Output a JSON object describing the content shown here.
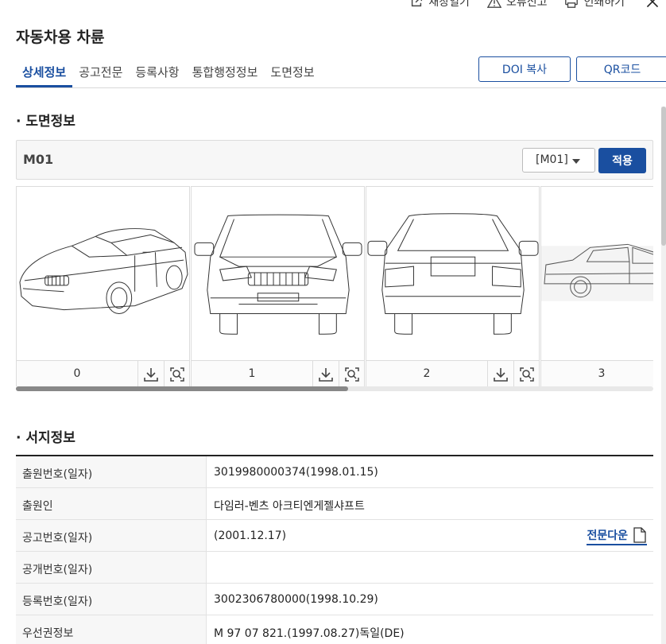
{
  "top_actions": {
    "new_window": "새창열기",
    "report_error": "오류신고",
    "print": "인쇄하기"
  },
  "title": "자동차용 차륜",
  "tabs": [
    {
      "label": "상세정보",
      "active": true
    },
    {
      "label": "공고전문",
      "active": false
    },
    {
      "label": "등록사항",
      "active": false
    },
    {
      "label": "통합행정정보",
      "active": false
    },
    {
      "label": "도면정보",
      "active": false
    }
  ],
  "buttons": {
    "doi_copy": "DOI 복사",
    "qr_code": "QR코드"
  },
  "drawing_section": {
    "title": "· 도면정보",
    "current_code": "M01",
    "select_value": "[M01]",
    "apply_label": "적용",
    "images": [
      {
        "index": "0",
        "view": "perspective"
      },
      {
        "index": "1",
        "view": "front"
      },
      {
        "index": "2",
        "view": "rear"
      },
      {
        "index": "3",
        "view": "side"
      }
    ]
  },
  "bib_section": {
    "title": "· 서지정보",
    "download_label": "전문다운",
    "rows": [
      {
        "key": "출원번호(일자)",
        "value": "3019980000374(1998.01.15)"
      },
      {
        "key": "출원인",
        "value": "다임러-벤츠 아크티엔게젤샤프트"
      },
      {
        "key": "공고번호(일자)",
        "value": "(2001.12.17)",
        "download": true
      },
      {
        "key": "공개번호(일자)",
        "value": ""
      },
      {
        "key": "등록번호(일자)",
        "value": "3002306780000(1998.10.29)"
      },
      {
        "key": "우선권정보",
        "value": "M 97 07 821.(1997.08.27)독일(DE)"
      }
    ]
  },
  "colors": {
    "accent": "#1a4fa0",
    "border": "#dcdcdc",
    "header_bg": "#f7f7f7"
  }
}
